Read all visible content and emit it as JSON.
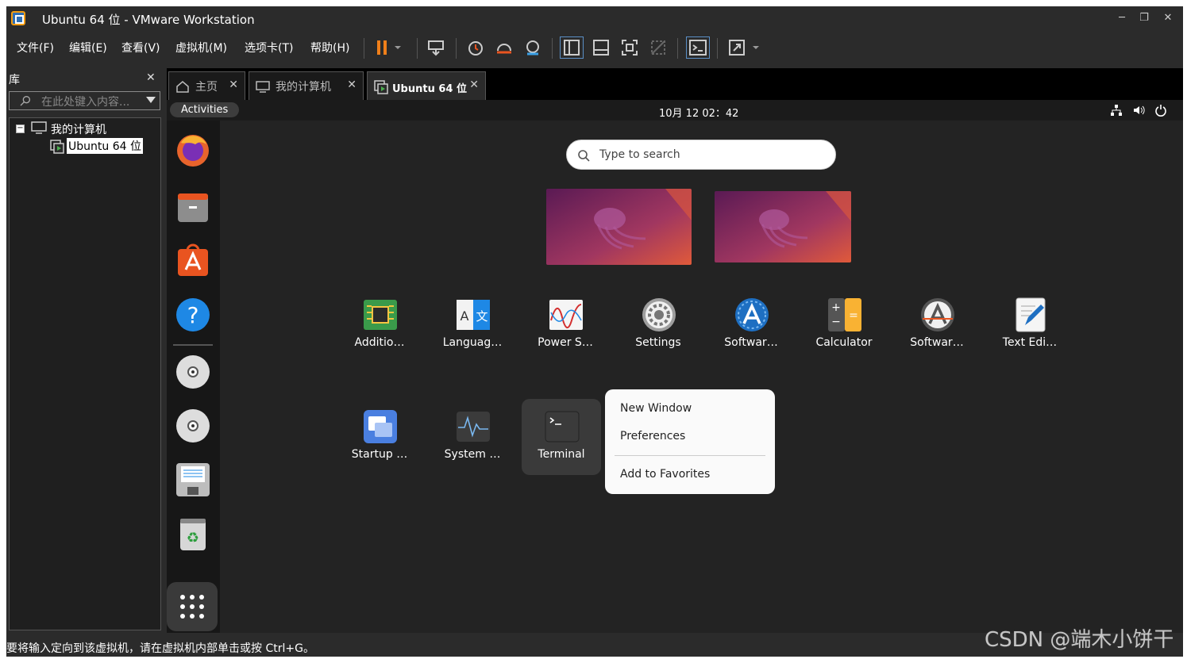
{
  "window": {
    "title": "Ubuntu 64 位 - VMware Workstation",
    "minimize": "─",
    "restore": "❐",
    "close": "✕"
  },
  "menu": [
    "文件(F)",
    "编辑(E)",
    "查看(V)",
    "虚拟机(M)",
    "选项卡(T)",
    "帮助(H)"
  ],
  "library": {
    "title": "库",
    "close": "✕",
    "search_placeholder": "在此处键入内容...",
    "tree": {
      "root": "我的计算机",
      "child": "Ubuntu 64 位"
    }
  },
  "tabs": [
    {
      "label": "主页",
      "close": "✕"
    },
    {
      "label": "我的计算机",
      "close": "✕"
    },
    {
      "label": "Ubuntu 64 位",
      "close": "✕"
    }
  ],
  "ubuntu": {
    "activities": "Activities",
    "clock": "10月 12  02：42",
    "search_placeholder": "Type to search",
    "apps_row1": [
      "Additio…",
      "Languag…",
      "Power S…",
      "Settings",
      "Softwar…",
      "Calculator",
      "Softwar…",
      "Text Edi…"
    ],
    "apps_row2": [
      "Startup …",
      "System …",
      "Terminal"
    ],
    "context_menu": [
      "New Window",
      "Preferences",
      "Add to Favorites"
    ]
  },
  "statusbar": "要将输入定向到该虚拟机，请在虚拟机内部单击或按 Ctrl+G。",
  "watermark": "CSDN @端木小饼干",
  "colors": {
    "accent_orange": "#e95420",
    "pause_orange": "#f07f1a",
    "window_bg": "#2b2b2b",
    "vm_bg": "#232323"
  }
}
